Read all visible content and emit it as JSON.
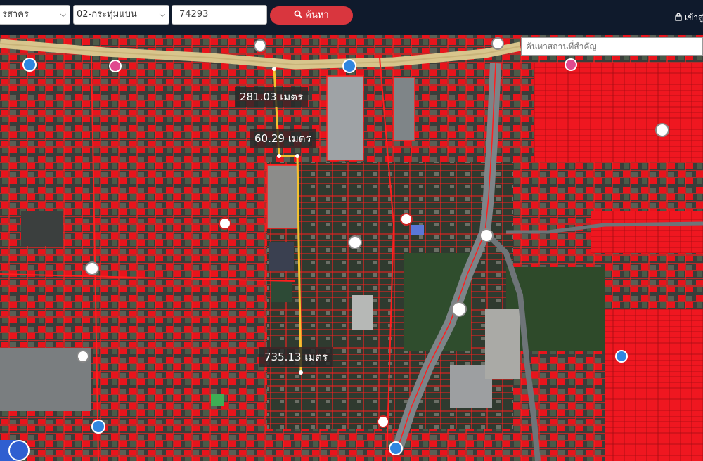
{
  "toolbar": {
    "province": "รสาคร",
    "district": "02-กระทุ่มแบน",
    "parcel_no": "74293",
    "search_button": "ค้นหา",
    "login": "เข้าสู่"
  },
  "map": {
    "place_search_placeholder": "ค้นหาสถานที่สำคัญ",
    "measurements": [
      "281.03 เมตร",
      "60.29 เมตร",
      "735.13 เมตร"
    ],
    "colors": {
      "parcel": "#e8141c",
      "line": "#f2c230",
      "topbar": "#0f1a2c",
      "button": "#d9363e"
    }
  }
}
